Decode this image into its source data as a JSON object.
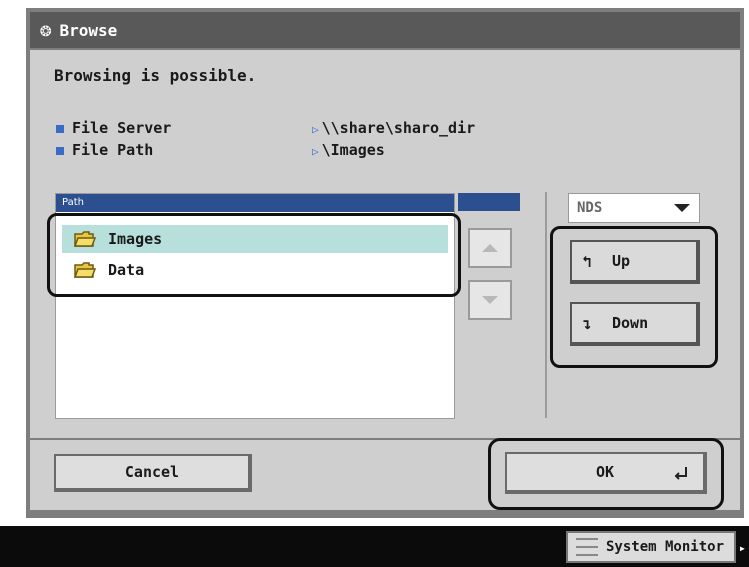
{
  "window": {
    "title": "Browse",
    "title_icon": "browse-globe-icon"
  },
  "status_text": "Browsing is possible.",
  "info": [
    {
      "label": "File Server",
      "value": "\\\\share\\sharo_dir"
    },
    {
      "label": "File Path",
      "value": "\\Images"
    }
  ],
  "list": {
    "header": "Path",
    "items": [
      {
        "name": "Images",
        "icon": "folder-icon",
        "selected": true
      },
      {
        "name": "Data",
        "icon": "folder-icon",
        "selected": false
      }
    ]
  },
  "protocol_select": {
    "value": "NDS"
  },
  "nav": {
    "up_label": "Up",
    "down_label": "Down"
  },
  "footer": {
    "cancel_label": "Cancel",
    "ok_label": "OK"
  },
  "system_monitor_label": "System Monitor",
  "colors": {
    "accent": "#2c4f8f",
    "selected_row": "#b7e0dd",
    "bullet": "#3a6cc7"
  }
}
